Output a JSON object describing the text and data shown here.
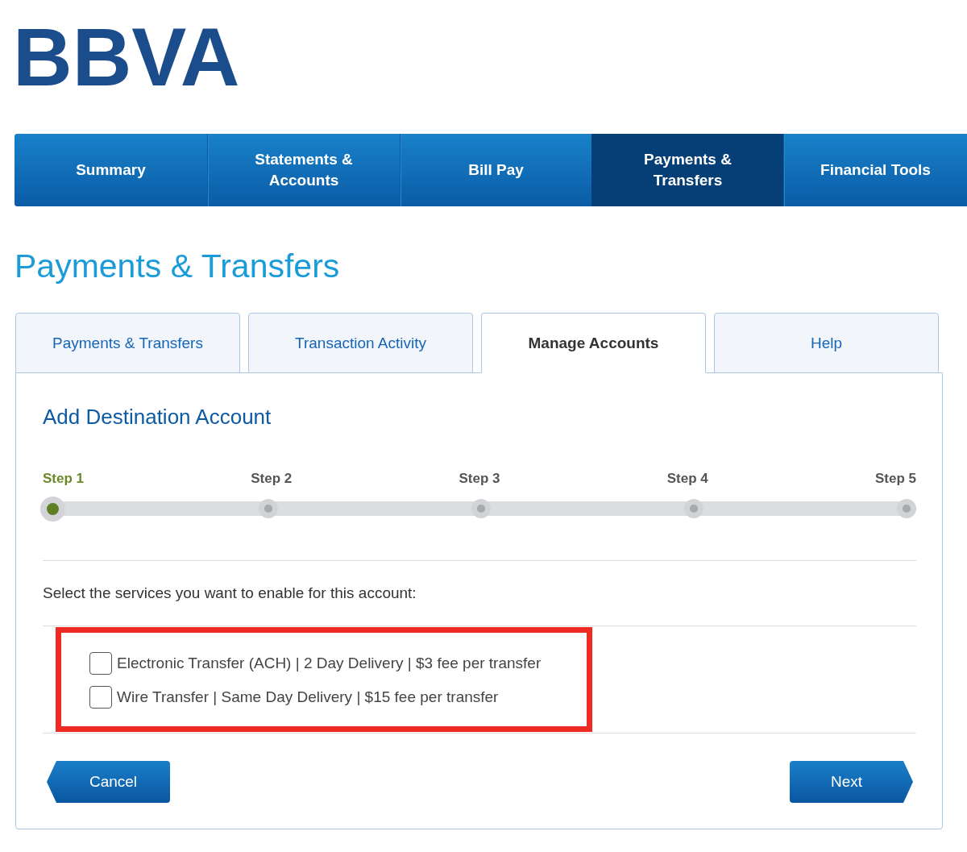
{
  "logo": {
    "text": "BBVA"
  },
  "main_nav": [
    {
      "label": "Summary",
      "selected": false
    },
    {
      "label": "Statements & Accounts",
      "selected": false
    },
    {
      "label": "Bill Pay",
      "selected": false
    },
    {
      "label": "Payments & Transfers",
      "selected": true
    },
    {
      "label": "Financial Tools",
      "selected": false
    }
  ],
  "page_title": "Payments & Transfers",
  "tabs": [
    {
      "label": "Payments & Transfers",
      "selected": false
    },
    {
      "label": "Transaction Activity",
      "selected": false
    },
    {
      "label": "Manage Accounts",
      "selected": true
    },
    {
      "label": "Help",
      "selected": false
    }
  ],
  "panel": {
    "title": "Add Destination Account",
    "steps": [
      {
        "label": "Step 1",
        "current": true
      },
      {
        "label": "Step 2",
        "current": false
      },
      {
        "label": "Step 3",
        "current": false
      },
      {
        "label": "Step 4",
        "current": false
      },
      {
        "label": "Step 5",
        "current": false
      }
    ],
    "instruction": "Select the services you want to enable for this account:",
    "services": [
      {
        "label": "Electronic Transfer (ACH) | 2 Day Delivery | $3 fee per transfer",
        "checked": false
      },
      {
        "label": "Wire Transfer | Same Day Delivery | $15 fee per transfer",
        "checked": false
      }
    ],
    "buttons": [
      {
        "label": "Cancel",
        "kind": "back"
      },
      {
        "label": "Next",
        "kind": "forward"
      }
    ]
  }
}
